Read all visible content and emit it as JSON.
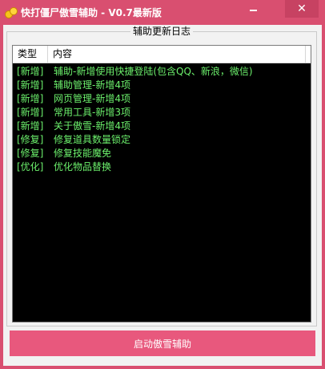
{
  "window": {
    "title": "快打僵尸傲雪辅助 - V0.7最新版",
    "minimize_glyph": "—",
    "close_glyph": "✕",
    "accent": "#d94f70"
  },
  "group": {
    "title": "辅助更新日志"
  },
  "list": {
    "columns": [
      "类型",
      "内容"
    ],
    "rows": [
      {
        "type": "[新增]",
        "content": "辅助-新增使用快捷登陆(包含QQ、新浪，微信)"
      },
      {
        "type": "[新增]",
        "content": "辅助管理-新增4项"
      },
      {
        "type": "[新增]",
        "content": "网页管理-新增4项"
      },
      {
        "type": "[新增]",
        "content": "常用工具-新增3项"
      },
      {
        "type": "[新增]",
        "content": "关于傲雪-新增4项"
      },
      {
        "type": "[修复]",
        "content": "修复道具数量锁定"
      },
      {
        "type": "[修复]",
        "content": "修复技能魔免"
      },
      {
        "type": "[优化]",
        "content": "优化物品替换"
      }
    ],
    "text_color": "#6cf06c"
  },
  "start_button": {
    "label": "启动傲雪辅助",
    "color": "#e8587d"
  }
}
